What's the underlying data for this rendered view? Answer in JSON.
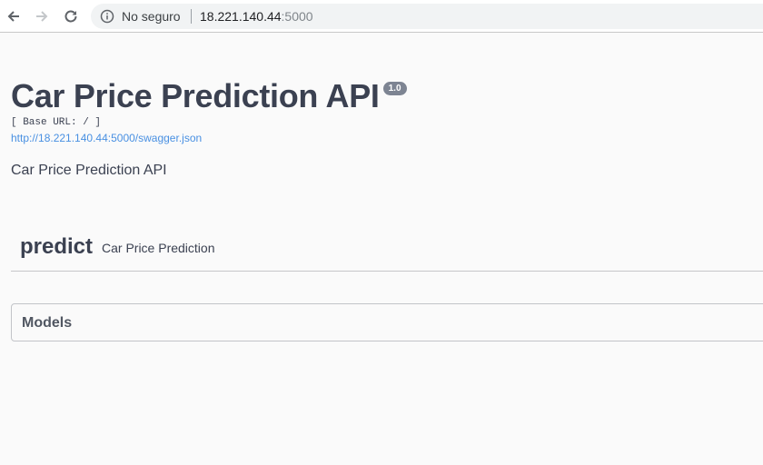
{
  "browser": {
    "security_label": "No seguro",
    "url_host": "18.221.140.44",
    "url_port": ":5000"
  },
  "api": {
    "title": "Car Price Prediction API",
    "version": "1.0",
    "base_url": "[ Base URL: / ]",
    "spec_link": "http://18.221.140.44:5000/swagger.json",
    "description": "Car Price Prediction API"
  },
  "tag": {
    "name": "predict",
    "description": "Car Price Prediction"
  },
  "models": {
    "title": "Models"
  },
  "icons": [
    "back-arrow-icon",
    "forward-arrow-icon",
    "reload-icon",
    "info-icon"
  ],
  "colors": {
    "link": "#4990e2",
    "text": "#3b4151",
    "badge": "#7d8492"
  }
}
